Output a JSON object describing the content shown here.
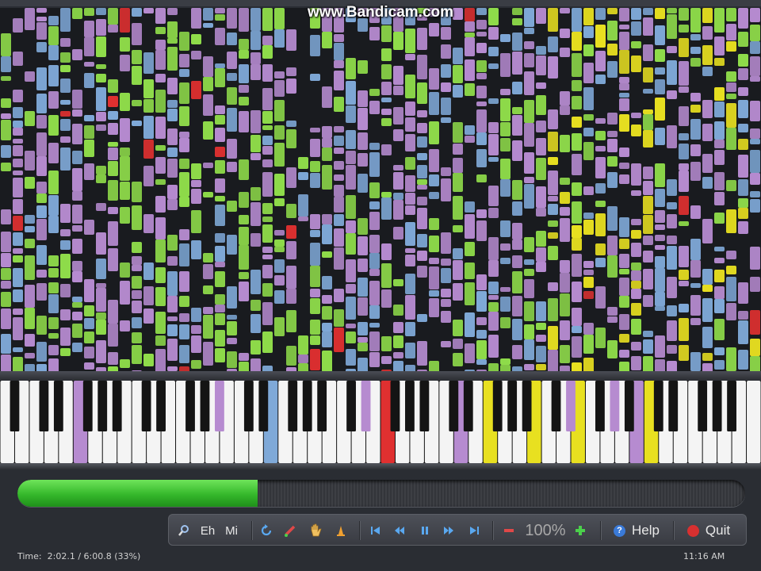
{
  "watermark": "www.Bandicam.com",
  "playback": {
    "progress_fraction": 0.33
  },
  "toolbar": {
    "zoom_label": "100%",
    "help_label": "Help",
    "quit_label": "Quit",
    "btn_eh": "Eh",
    "btn_mi": "Mi"
  },
  "status": {
    "time_label": "Time:",
    "time_value": "2:02.1 / 6:00.8 (33%)",
    "clock": "11:16 AM"
  },
  "colors": {
    "note_purple": "#b68bd0",
    "note_blue": "#7fa9d8",
    "note_green": "#8fdc4a",
    "note_yellow": "#e8e020",
    "note_red": "#e03030",
    "progress_green": "#44c436"
  },
  "icons": [
    "search-icon",
    "rewind-icon",
    "pencil-icon",
    "hand-icon",
    "metronome-icon",
    "skip-start-icon",
    "step-back-icon",
    "pause-icon",
    "step-forward-icon",
    "skip-end-icon",
    "zoom-out-icon",
    "zoom-in-icon",
    "help-icon",
    "quit-icon"
  ]
}
